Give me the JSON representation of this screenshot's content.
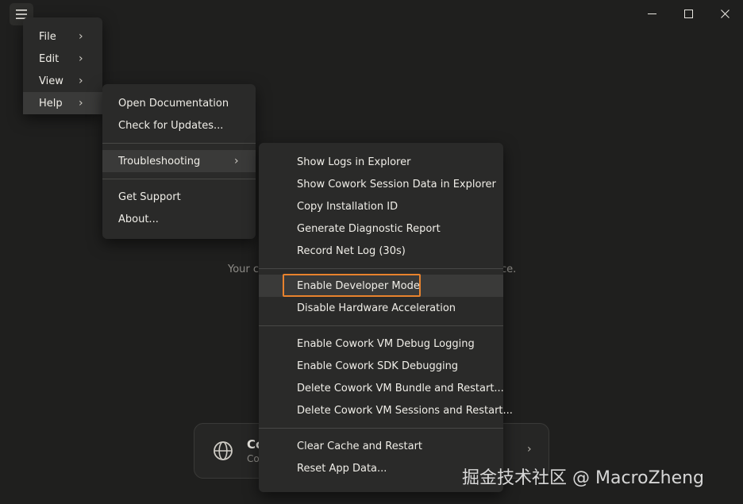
{
  "menu_bar": {
    "items": [
      {
        "label": "File",
        "chevron": "›"
      },
      {
        "label": "Edit",
        "chevron": "›"
      },
      {
        "label": "View",
        "chevron": "›"
      },
      {
        "label": "Help",
        "chevron": "›"
      }
    ]
  },
  "help_menu": {
    "items": [
      {
        "label": "Open Documentation"
      },
      {
        "label": "Check for Updates..."
      },
      {
        "label": "Troubleshooting",
        "chevron": "›"
      },
      {
        "label": "Get Support"
      },
      {
        "label": "About..."
      }
    ]
  },
  "troubleshooting_menu": {
    "items": [
      {
        "label": "Show Logs in Explorer"
      },
      {
        "label": "Show Cowork Session Data in Explorer"
      },
      {
        "label": "Copy Installation ID"
      },
      {
        "label": "Generate Diagnostic Report"
      },
      {
        "label": "Record Net Log (30s)"
      },
      {
        "label": "Enable Developer Mode"
      },
      {
        "label": "Disable Hardware Acceleration"
      },
      {
        "label": "Enable Cowork VM Debug Logging"
      },
      {
        "label": "Enable Cowork SDK Debugging"
      },
      {
        "label": "Delete Cowork VM Bundle and Restart..."
      },
      {
        "label": "Delete Cowork VM Sessions and Restart..."
      },
      {
        "label": "Clear Cache and Restart"
      },
      {
        "label": "Reset App Data..."
      }
    ]
  },
  "background": {
    "text_start": "Your c",
    "text_end": "ce.",
    "card_title": "Co",
    "card_sub": "Co",
    "card_chevron": "›"
  },
  "watermark": "掘金技术社区 @ MacroZheng",
  "colors": {
    "background": "#1f1f1e",
    "menu": "#2a2a29",
    "highlight": "#e8822d"
  }
}
